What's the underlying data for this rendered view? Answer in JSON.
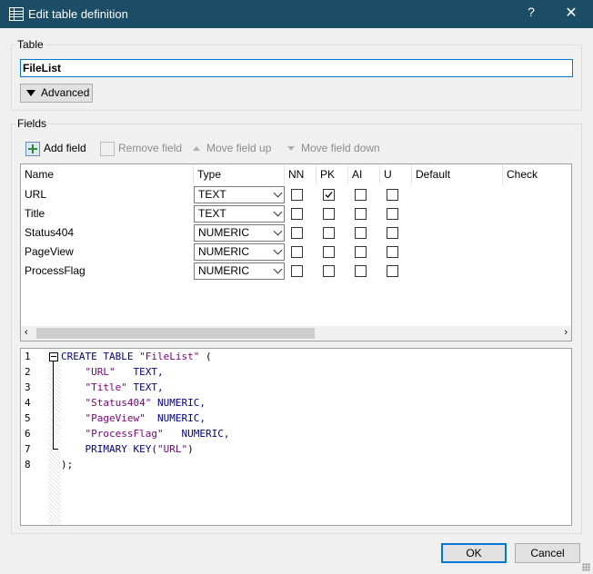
{
  "window": {
    "title": "Edit table definition",
    "help": "?",
    "close": "✕"
  },
  "table": {
    "group_label": "Table",
    "name_value": "FileList",
    "advanced_label": "Advanced"
  },
  "fields": {
    "group_label": "Fields",
    "toolbar": {
      "add": "Add field",
      "remove": "Remove field",
      "move_up": "Move field up",
      "move_down": "Move field down"
    },
    "columns": [
      "Name",
      "Type",
      "NN",
      "PK",
      "AI",
      "U",
      "Default",
      "Check"
    ],
    "rows": [
      {
        "name": "URL",
        "type": "TEXT",
        "nn": false,
        "pk": true,
        "ai": false,
        "u": false
      },
      {
        "name": "Title",
        "type": "TEXT",
        "nn": false,
        "pk": false,
        "ai": false,
        "u": false
      },
      {
        "name": "Status404",
        "type": "NUMERIC",
        "nn": false,
        "pk": false,
        "ai": false,
        "u": false
      },
      {
        "name": "PageView",
        "type": "NUMERIC",
        "nn": false,
        "pk": false,
        "ai": false,
        "u": false
      },
      {
        "name": "ProcessFlag",
        "type": "NUMERIC",
        "nn": false,
        "pk": false,
        "ai": false,
        "u": false
      }
    ]
  },
  "sql": {
    "line_numbers": [
      "1",
      "2",
      "3",
      "4",
      "5",
      "6",
      "7",
      "8"
    ],
    "lines": [
      [
        {
          "t": "CREATE TABLE ",
          "c": "kw"
        },
        {
          "t": "\"FileList\"",
          "c": "str"
        },
        {
          "t": " (",
          "c": "pl"
        }
      ],
      [
        {
          "t": "    ",
          "c": "pl"
        },
        {
          "t": "\"URL\"",
          "c": "str"
        },
        {
          "t": "   TEXT,",
          "c": "kw"
        }
      ],
      [
        {
          "t": "    ",
          "c": "pl"
        },
        {
          "t": "\"Title\"",
          "c": "str"
        },
        {
          "t": " TEXT,",
          "c": "kw"
        }
      ],
      [
        {
          "t": "    ",
          "c": "pl"
        },
        {
          "t": "\"Status404\"",
          "c": "str"
        },
        {
          "t": " NUMERIC,",
          "c": "kw"
        }
      ],
      [
        {
          "t": "    ",
          "c": "pl"
        },
        {
          "t": "\"PageView\"",
          "c": "str"
        },
        {
          "t": "  NUMERIC,",
          "c": "kw"
        }
      ],
      [
        {
          "t": "    ",
          "c": "pl"
        },
        {
          "t": "\"ProcessFlag\"",
          "c": "str"
        },
        {
          "t": "   NUMERIC,",
          "c": "kw"
        }
      ],
      [
        {
          "t": "    PRIMARY KEY(",
          "c": "kw"
        },
        {
          "t": "\"URL\"",
          "c": "str"
        },
        {
          "t": ")",
          "c": "pl"
        }
      ],
      [
        {
          "t": ");",
          "c": "pl"
        }
      ]
    ]
  },
  "buttons": {
    "ok": "OK",
    "cancel": "Cancel"
  }
}
